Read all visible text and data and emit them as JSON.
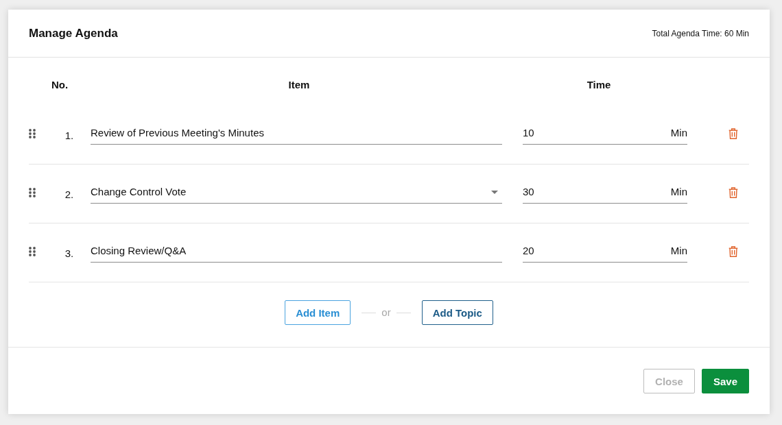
{
  "dialog": {
    "title": "Manage Agenda",
    "total_time": "Total Agenda Time: 60 Min"
  },
  "table": {
    "columns": [
      "No.",
      "Item",
      "Time"
    ],
    "rows": [
      {
        "number": "1.",
        "kind": "text",
        "item": "Review of Previous Meeting's Minutes",
        "time": "10",
        "unit": "Min"
      },
      {
        "number": "2.",
        "kind": "select",
        "item": "Change Control Vote",
        "time": "30",
        "unit": "Min"
      },
      {
        "number": "3.",
        "kind": "text",
        "item": "Closing Review/Q&A",
        "time": "20",
        "unit": "Min"
      }
    ]
  },
  "add_actions": {
    "buttons": [
      {
        "label": "Add Item",
        "kind": "light"
      },
      {
        "label": "Add Topic",
        "kind": "dark"
      }
    ],
    "separator": "or"
  },
  "footer": {
    "buttons": [
      {
        "label": "Close",
        "kind": "muted"
      },
      {
        "label": "Save",
        "kind": "solid"
      }
    ]
  }
}
